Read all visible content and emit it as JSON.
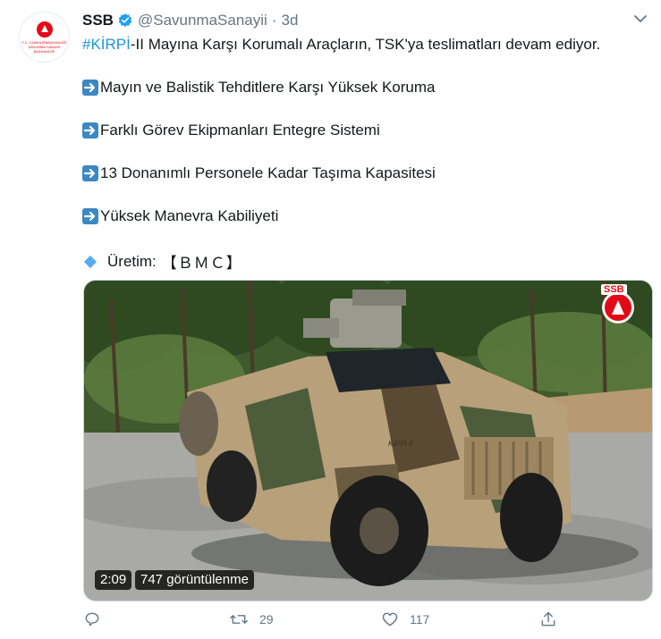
{
  "tweet": {
    "author_name": "SSB",
    "handle": "@SavunmaSanayii",
    "separator": "·",
    "time": "3d",
    "hashtag": "#KİRPİ",
    "headline_rest": "-II Mayına Karşı Korumalı Araçların, TSK'ya teslimatları devam ediyor.",
    "bullets": [
      "Mayın ve Balistik Tehditlere Karşı Yüksek Koruma",
      "Farklı Görev Ekipmanları Entegre Sistemi",
      "13 Donanımlı Personele Kadar Taşıma Kapasitesi",
      "Yüksek Manevra Kabiliyeti"
    ],
    "producer_label": "Üretim:",
    "producer_value": "【ＢＭＣ】"
  },
  "video": {
    "duration": "2:09",
    "views": "747 görüntülenme",
    "logo_text": "SSB",
    "vehicle_marking": "KIRPI II"
  },
  "actions": {
    "reply_count": "",
    "retweet_count": "29",
    "like_count": "117"
  },
  "colors": {
    "link": "#1b95e0",
    "muted": "#657786",
    "verified": "#1da1f2",
    "brand_red": "#e30a17"
  },
  "icons": [
    "verified-badge-icon",
    "chevron-down-icon",
    "right-arrow-emoji-icon",
    "diamond-emoji-icon",
    "reply-icon",
    "retweet-icon",
    "like-icon",
    "share-icon"
  ]
}
